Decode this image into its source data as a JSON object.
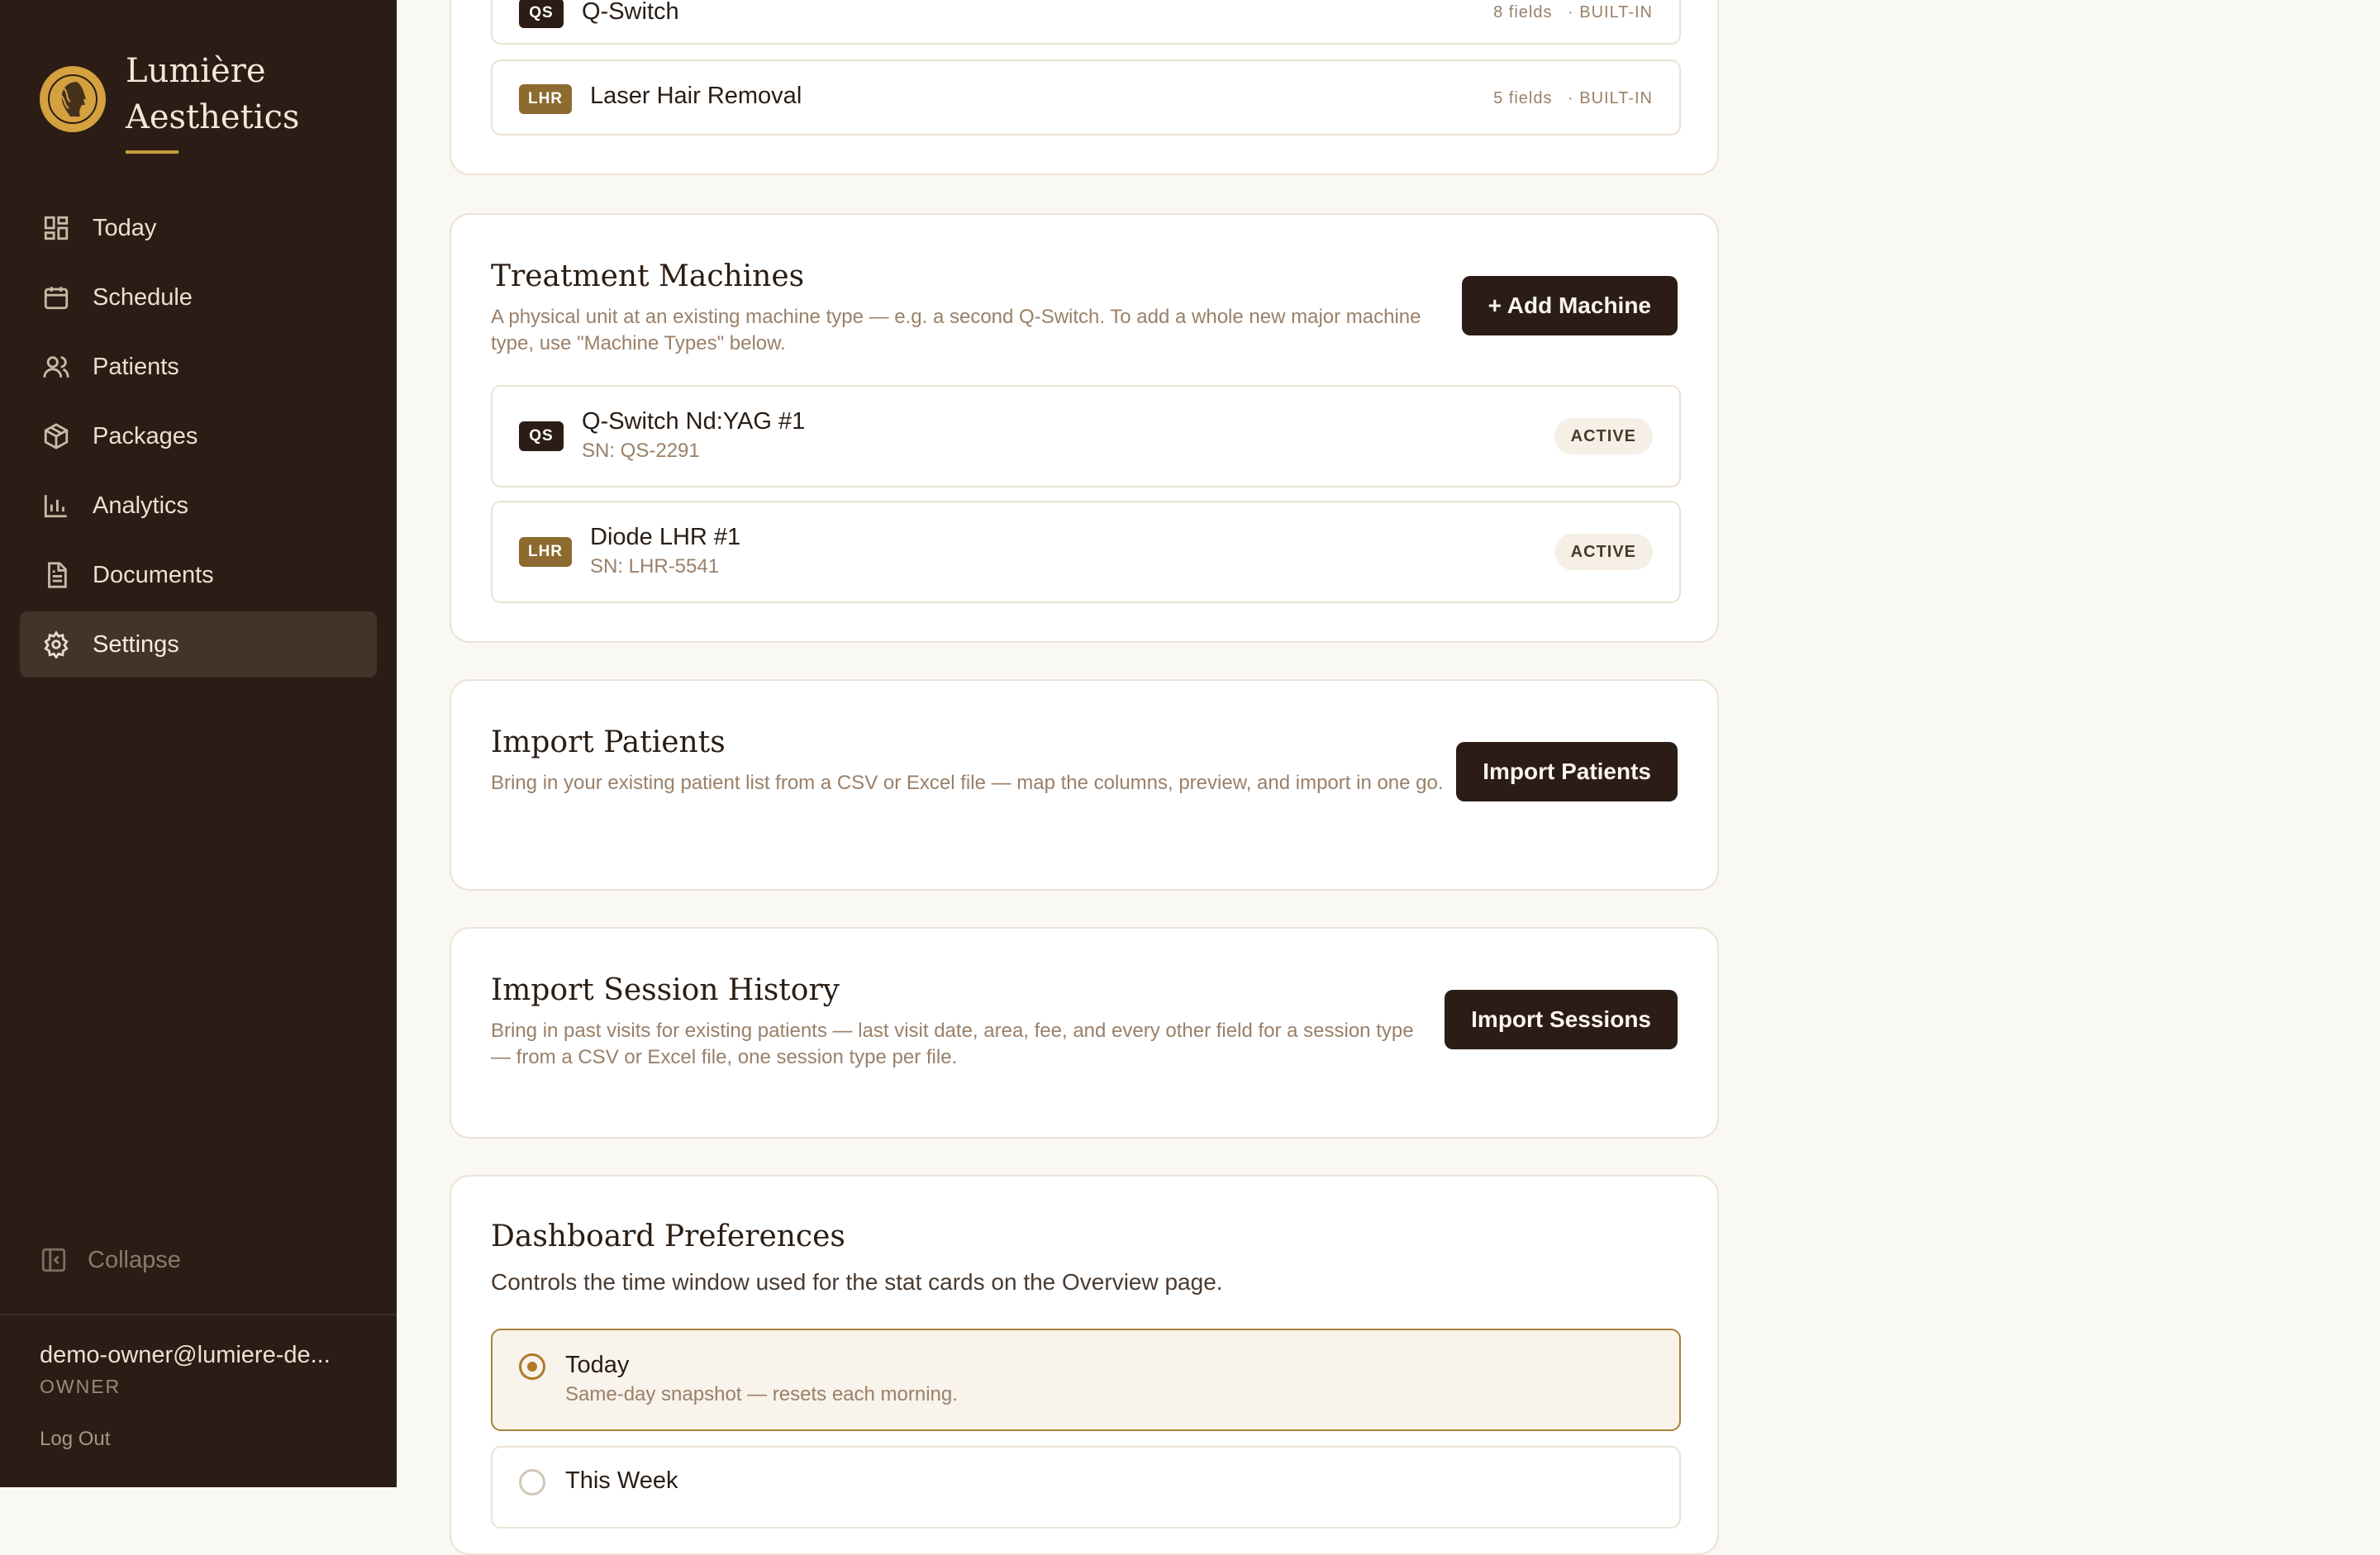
{
  "sidebar": {
    "brand": {
      "line1": "Lumière",
      "line2": "Aesthetics"
    },
    "items": [
      {
        "label": "Today",
        "icon": "grid-icon"
      },
      {
        "label": "Schedule",
        "icon": "calendar-icon"
      },
      {
        "label": "Patients",
        "icon": "users-icon"
      },
      {
        "label": "Packages",
        "icon": "box-icon"
      },
      {
        "label": "Analytics",
        "icon": "bar-chart-icon"
      },
      {
        "label": "Documents",
        "icon": "document-icon"
      },
      {
        "label": "Settings",
        "icon": "gear-icon",
        "active": true
      }
    ],
    "collapse_label": "Collapse",
    "user": {
      "email": "demo-owner@lumiere-de...",
      "role": "OWNER"
    },
    "logout_label": "Log Out"
  },
  "machine_types": {
    "rows": [
      {
        "tag": "QS",
        "name": "Q-Switch",
        "fields": "8 fields",
        "kind": "· BUILT-IN"
      },
      {
        "tag": "LHR",
        "name": "Laser Hair Removal",
        "fields": "5 fields",
        "kind": "· BUILT-IN"
      }
    ]
  },
  "treatment_machines": {
    "title": "Treatment Machines",
    "description": "A physical unit at an existing machine type — e.g. a second Q-Switch. To add a whole new major machine type, use \"Machine Types\" below.",
    "add_button": "+ Add Machine",
    "rows": [
      {
        "tag": "QS",
        "name": "Q-Switch Nd:YAG #1",
        "serial": "SN: QS-2291",
        "status": "ACTIVE"
      },
      {
        "tag": "LHR",
        "name": "Diode LHR #1",
        "serial": "SN: LHR-5541",
        "status": "ACTIVE"
      }
    ]
  },
  "import_patients": {
    "title": "Import Patients",
    "description": "Bring in your existing patient list from a CSV or Excel file — map the columns, preview, and import in one go.",
    "button": "Import Patients"
  },
  "import_sessions": {
    "title": "Import Session History",
    "description": "Bring in past visits for existing patients — last visit date, area, fee, and every other field for a session type — from a CSV or Excel file, one session type per file.",
    "button": "Import Sessions"
  },
  "dashboard_prefs": {
    "title": "Dashboard Preferences",
    "description": "Controls the time window used for the stat cards on the Overview page.",
    "options": [
      {
        "label": "Today",
        "sub": "Same-day snapshot — resets each morning.",
        "selected": true
      },
      {
        "label": "This Week",
        "selected": false
      }
    ]
  },
  "colors": {
    "sidebar_bg": "#2b1d15",
    "accent_gold": "#d4a040",
    "button_dark": "#2b1d15",
    "page_bg": "#faf8f4"
  }
}
